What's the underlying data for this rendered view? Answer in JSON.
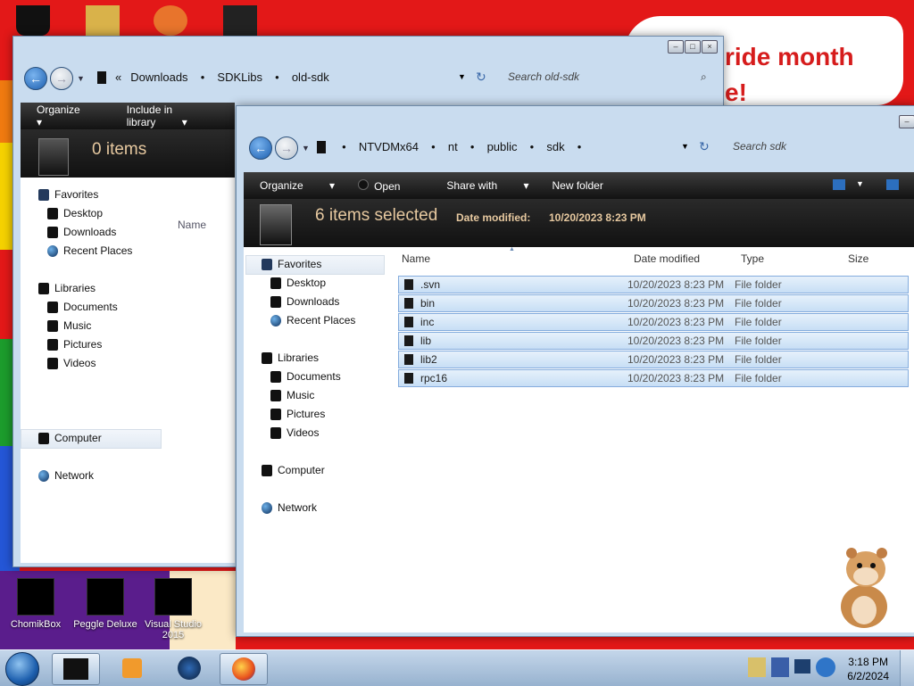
{
  "desktop": {
    "banner_line1": "ride month",
    "banner_line2": "e!",
    "icons": [
      {
        "label": "ChomikBox"
      },
      {
        "label": "Peggle Deluxe"
      },
      {
        "label": "Visual Studio 2015"
      }
    ]
  },
  "back_window": {
    "breadcrumb": [
      "Downloads",
      "SDKLibs",
      "old-sdk"
    ],
    "breadcrumb_prefix": "«",
    "search_placeholder": "Search old-sdk",
    "toolbar": {
      "organize": "Organize",
      "include": "Include in library"
    },
    "details": {
      "count": "0 items"
    },
    "column_name": "Name",
    "nav": {
      "favorites": "Favorites",
      "desktop": "Desktop",
      "downloads": "Downloads",
      "recent": "Recent Places",
      "libraries": "Libraries",
      "documents": "Documents",
      "music": "Music",
      "pictures": "Pictures",
      "videos": "Videos",
      "computer": "Computer",
      "network": "Network"
    }
  },
  "front_window": {
    "breadcrumb": [
      "NTVDMx64",
      "nt",
      "public",
      "sdk"
    ],
    "search_placeholder": "Search sdk",
    "toolbar": {
      "organize": "Organize",
      "open": "Open",
      "share": "Share with",
      "newfolder": "New folder"
    },
    "details": {
      "count": "6 items selected",
      "modified_label": "Date modified:",
      "modified_value": "10/20/2023 8:23 PM"
    },
    "columns": {
      "name": "Name",
      "modified": "Date modified",
      "type": "Type",
      "size": "Size"
    },
    "files": [
      {
        "name": ".svn",
        "modified": "10/20/2023 8:23 PM",
        "type": "File folder"
      },
      {
        "name": "bin",
        "modified": "10/20/2023 8:23 PM",
        "type": "File folder"
      },
      {
        "name": "inc",
        "modified": "10/20/2023 8:23 PM",
        "type": "File folder"
      },
      {
        "name": "lib",
        "modified": "10/20/2023 8:23 PM",
        "type": "File folder"
      },
      {
        "name": "lib2",
        "modified": "10/20/2023 8:23 PM",
        "type": "File folder"
      },
      {
        "name": "rpc16",
        "modified": "10/20/2023 8:23 PM",
        "type": "File folder"
      }
    ],
    "nav": {
      "favorites": "Favorites",
      "desktop": "Desktop",
      "downloads": "Downloads",
      "recent": "Recent Places",
      "libraries": "Libraries",
      "documents": "Documents",
      "music": "Music",
      "pictures": "Pictures",
      "videos": "Videos",
      "computer": "Computer",
      "network": "Network"
    }
  },
  "taskbar": {
    "time": "3:18 PM",
    "date": "6/2/2024"
  }
}
